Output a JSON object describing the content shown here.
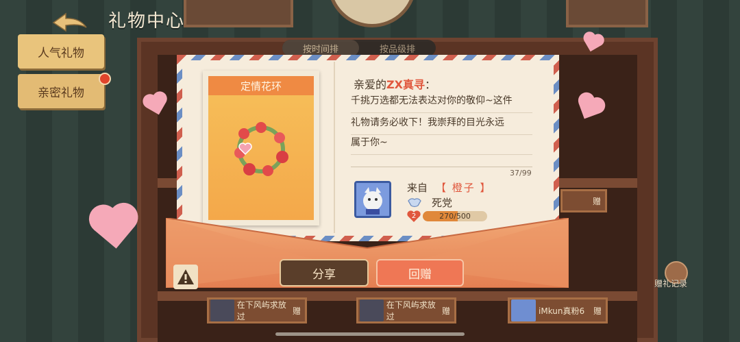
{
  "header": {
    "title": "礼物中心"
  },
  "side_tabs": [
    {
      "label": "人气礼物"
    },
    {
      "label": "亲密礼物"
    }
  ],
  "sort_tabs": [
    {
      "label": "按时间排",
      "active": true
    },
    {
      "label": "按品级排",
      "active": false
    }
  ],
  "gift_card": {
    "name": "定情花环"
  },
  "letter": {
    "greeting_prefix": "亲爱的",
    "recipient": "ZX真寻",
    "greeting_suffix": "：",
    "message_lines": [
      "千挑万选都无法表达对你的敬仰~这件",
      "礼物请务必收下！我崇拜的目光永远",
      "属于你~"
    ],
    "char_count": "37/99",
    "from_label": "来自",
    "sender": "【 橙子 】",
    "relation": "死党",
    "intimacy_level": "2",
    "intimacy_progress": "270/500",
    "intimacy_fraction": 0.54
  },
  "buttons": {
    "share": "分享",
    "reply": "回赠"
  },
  "gift_record_label": "赠礼记录",
  "shelf_items": [
    {
      "text": "在下风屿求放过",
      "suffix": "赠"
    },
    {
      "text": "在下风屿求放过",
      "suffix": "赠"
    },
    {
      "text": "iMkun真粉6",
      "suffix": "赠"
    }
  ],
  "side_plaque_suffix": "赠",
  "colors": {
    "accent_red": "#e0573d",
    "card_orange": "#ef8a43",
    "reply_button": "#ef7755"
  },
  "icons": [
    "back-arrow-icon",
    "warning-icon",
    "gift-record-icon",
    "handshake-icon",
    "heart-level-icon"
  ]
}
